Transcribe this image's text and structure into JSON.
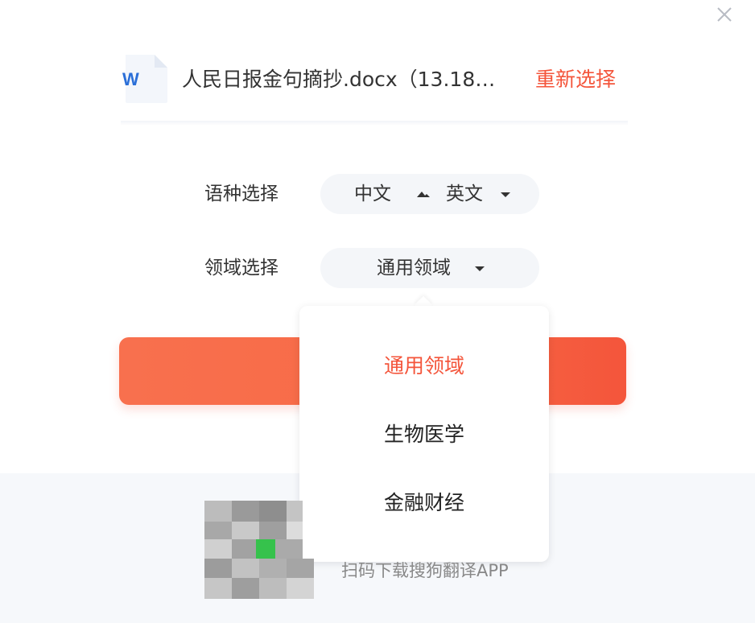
{
  "file": {
    "icon_letter": "W",
    "name": "人民日报金句摘抄.docx（13.18…",
    "reselect_label": "重新选择"
  },
  "language": {
    "label": "语种选择",
    "source": "中文",
    "target": "英文"
  },
  "domain": {
    "label": "领域选择",
    "selected": "通用领域",
    "options": [
      "通用领域",
      "生物医学",
      "金融财经"
    ]
  },
  "footer": {
    "caption": "扫码下载搜狗翻译APP"
  },
  "colors": {
    "accent": "#f4553b",
    "button_start": "#f8704e",
    "button_end": "#f4553b",
    "pill_bg": "#f4f6f9",
    "footer_bg": "#f6f8fb",
    "word_blue": "#2b6fd8"
  },
  "icons": {
    "close": "close-icon",
    "file": "word-file-icon",
    "swap": "swap-icon",
    "caret": "chevron-down-icon",
    "qr": "qr-code-icon"
  }
}
